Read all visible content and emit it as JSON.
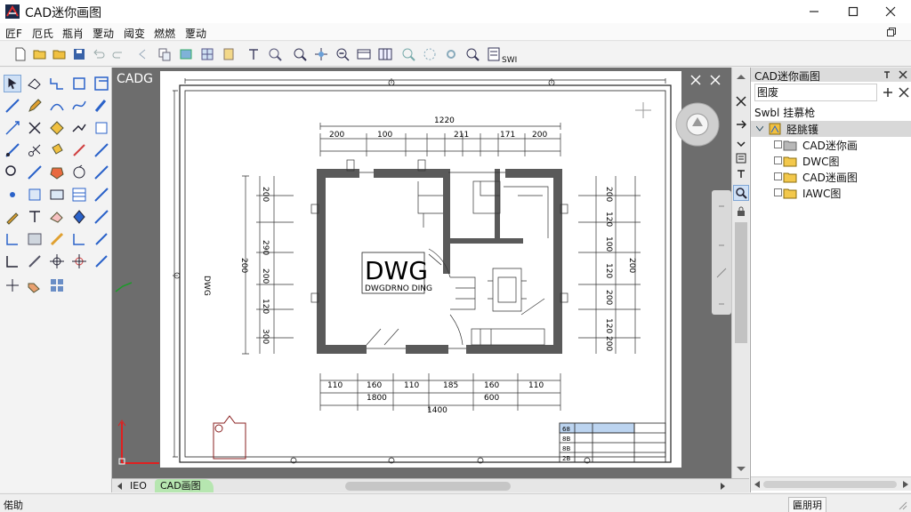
{
  "window": {
    "title": "CAD迷你画图"
  },
  "menu": {
    "items": [
      "匠F",
      "厄氏",
      "瓶肖",
      "覂动",
      "阈变",
      "燃燃",
      "覂动"
    ]
  },
  "toolbar": {
    "end_text": "SWI"
  },
  "canvas": {
    "label": "CADG",
    "drawing": {
      "title": "DWG",
      "subtitle": "DWGDRNO DING",
      "top_overall": "1220",
      "top_dims": [
        "200",
        "100",
        "211",
        "171",
        "200"
      ],
      "bottom_dims": [
        "110",
        "160",
        "110",
        "185",
        "160",
        "110"
      ],
      "bottom_totals": [
        "1800",
        "600"
      ],
      "bottom_extra": "1400",
      "left_label": "DWG",
      "left_overall": "200",
      "left_dims": [
        "200",
        "290",
        "200",
        "120",
        "300"
      ],
      "right_dims": [
        "200",
        "120",
        "100",
        "120",
        "200",
        "120",
        "200"
      ],
      "right_overall": "200"
    },
    "titleblock_cells": [
      "68",
      "8B",
      "8B",
      "2B"
    ]
  },
  "tabs": {
    "items": [
      "IEO",
      "CAD画图"
    ]
  },
  "status": {
    "left": "偌助",
    "right": "匾朋玥"
  },
  "panel": {
    "title": "CAD迷你画图",
    "search_value": "图废",
    "section": "Swbl 挂慕枪",
    "root": "胫脁镬",
    "items": [
      "CAD迷你画",
      "DWC图",
      "CAD迷画图",
      "IAWC图"
    ]
  },
  "colors": {
    "accent": "#0078d7",
    "tab_active": "#b6e6b0",
    "panel_header": "#dcdcdc",
    "canvas_bg": "#6d6d6d"
  }
}
